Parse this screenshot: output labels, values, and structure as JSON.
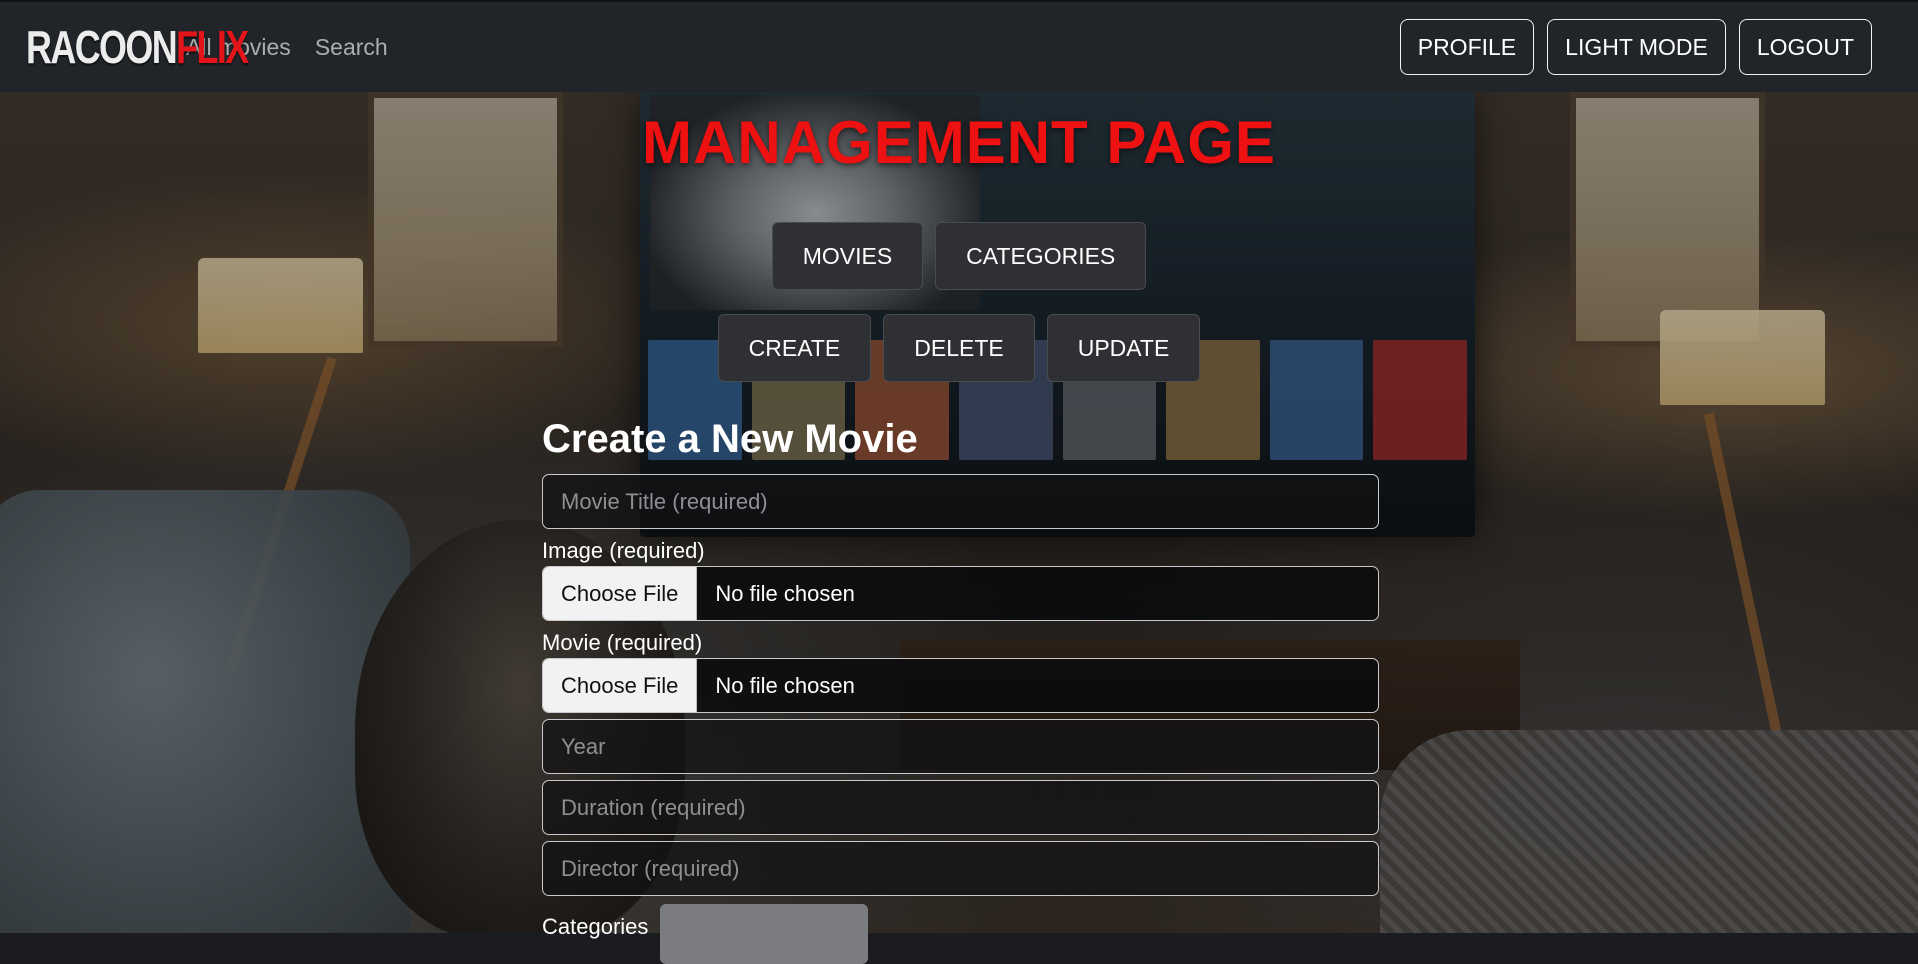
{
  "navbar": {
    "logo_part1": "RACOON",
    "logo_part2": "FLIX",
    "links": [
      "All movies",
      "Search"
    ],
    "buttons": [
      "PROFILE",
      "LIGHT MODE",
      "LOGOUT"
    ]
  },
  "page": {
    "title": "MANAGEMENT PAGE",
    "section_buttons": [
      "MOVIES",
      "CATEGORIES"
    ],
    "action_buttons": [
      "CREATE",
      "DELETE",
      "UPDATE"
    ]
  },
  "form": {
    "title": "Create a New Movie",
    "movie_title_placeholder": "Movie Title (required)",
    "image_label": "Image (required)",
    "movie_label": "Movie (required)",
    "file_button": "Choose File",
    "file_status": "No file chosen",
    "year_placeholder": "Year",
    "duration_placeholder": "Duration (required)",
    "director_placeholder": "Director (required)",
    "categories_label": "Categories"
  },
  "colors": {
    "navbar_bg": "#212529",
    "title_red": "#ee1111",
    "logo_red": "#e4141b",
    "button_bg": "#2f3033"
  }
}
